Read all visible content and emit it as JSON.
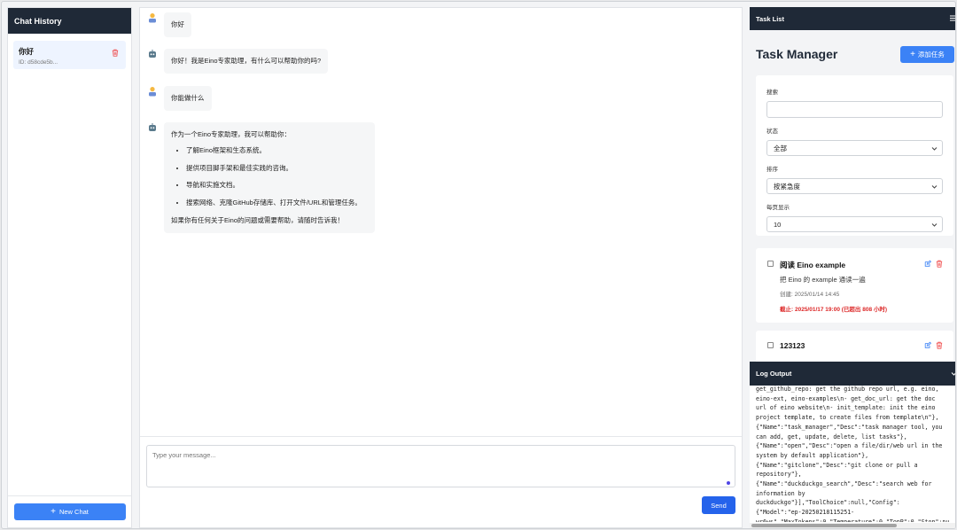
{
  "sidebar": {
    "header": "Chat History",
    "chats": [
      {
        "title": "你好",
        "id": "ID: d58cde5b..."
      }
    ],
    "new_chat_label": "New Chat",
    "new_chat_icon": "+"
  },
  "chat": {
    "messages": [
      {
        "role": "user",
        "text": "你好"
      },
      {
        "role": "assistant",
        "text": "你好！我是Eino专家助理，有什么可以帮助你的吗?"
      },
      {
        "role": "user",
        "text": "你能做什么"
      },
      {
        "role": "assistant",
        "intro": "作为一个Eino专家助理，我可以帮助你：",
        "items": [
          "了解Eino框架和生态系统。",
          "提供项目脚手架和最佳实践的咨询。",
          "导航和实施文档。",
          "搜索网络、克隆GitHub存储库、打开文件/URL和管理任务。"
        ],
        "outro": "如果你有任何关于Eino的问题或需要帮助，请随时告诉我！"
      }
    ],
    "input_placeholder": "Type your message...",
    "send_label": "Send"
  },
  "tasks": {
    "header": "Task List",
    "title": "Task Manager",
    "add_label": "添加任务",
    "add_icon": "+",
    "filters": {
      "search_label": "搜索",
      "status_label": "状态",
      "status_value": "全部",
      "sort_label": "排序",
      "sort_value": "按紧急度",
      "per_page_label": "每页显示",
      "per_page_value": "10"
    },
    "items": [
      {
        "title": "阅读 Eino example",
        "desc": "把 Eino 的 example 通读一遍",
        "created": "创建: 2025/01/14 14:45",
        "due": "截止: 2025/01/17 19:00 (已超出 808 小时)"
      },
      {
        "title": "123123"
      }
    ]
  },
  "log": {
    "header": "Log Output",
    "lines": [
      "get_github_repo: get the github repo url, e.g. eino,",
      "eino-ext, eino-examples\\n- get_doc_url: get the doc",
      "url of eino website\\n- init_template: init the eino",
      "project template, to create files from template\\n\"},",
      "{\"Name\":\"task_manager\",\"Desc\":\"task manager tool, you",
      "can add, get, update, delete, list tasks\"},",
      "{\"Name\":\"open\",\"Desc\":\"open a file/dir/web url in the",
      "system by default application\"},",
      "{\"Name\":\"gitclone\",\"Desc\":\"git clone or pull a",
      "repository\"},",
      "{\"Name\":\"duckduckgo_search\",\"Desc\":\"search web for",
      "information by",
      "duckduckgo\"}],\"ToolChoice\":null,\"Config\":",
      "{\"Model\":\"ep-20250218115251-",
      "wr6ws\",\"MaxTokens\":0,\"Temperature\":0,\"TopP\":0,\"Stop\":nu"
    ]
  },
  "colors": {
    "accent": "#3b82f6",
    "dark": "#1f2937",
    "danger": "#dc2626"
  }
}
